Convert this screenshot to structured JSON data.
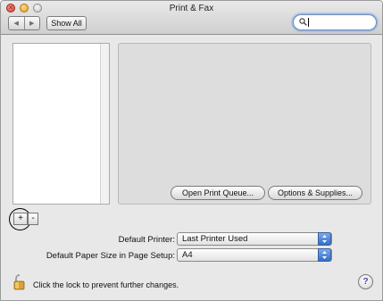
{
  "window": {
    "title": "Print & Fax",
    "close_glyph": "×"
  },
  "toolbar": {
    "back_icon": "◀",
    "forward_icon": "▶",
    "show_all_label": "Show All",
    "search_icon": "🔍",
    "search_value": ""
  },
  "printer_list": {
    "items": []
  },
  "actions": {
    "open_print_queue_label": "Open Print Queue...",
    "options_supplies_label": "Options & Supplies...",
    "add_label": "+",
    "remove_label": "-"
  },
  "settings": {
    "default_printer_label": "Default Printer:",
    "default_printer_value": "Last Printer Used",
    "default_paper_label": "Default Paper Size in Page Setup:",
    "default_paper_value": "A4",
    "popup_arrows": "▲▼"
  },
  "footer": {
    "lock_text": "Click the lock to prevent further changes.",
    "help_label": "?"
  },
  "colors": {
    "window_bg": "#e8e8e8",
    "accent_blue": "#2f6fcf",
    "help_purple": "#5a3aa8"
  }
}
